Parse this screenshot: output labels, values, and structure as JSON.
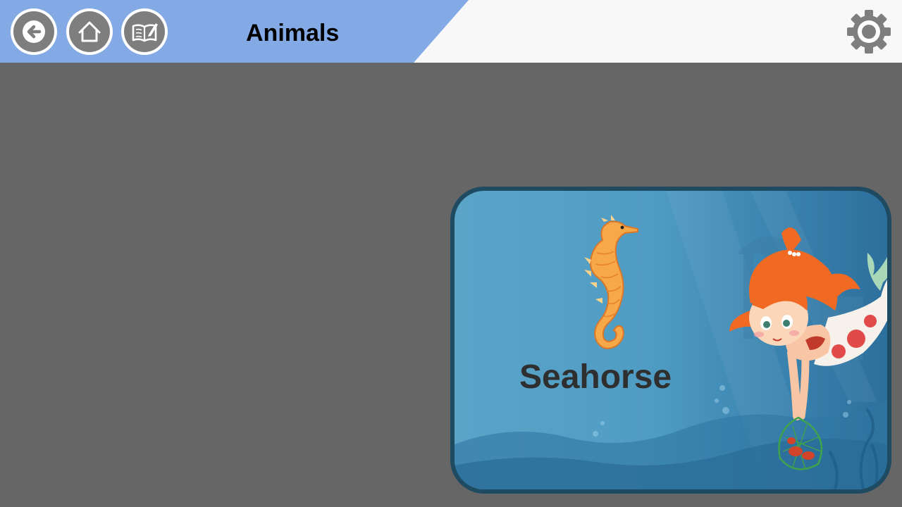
{
  "header": {
    "title": "Animals",
    "buttons": {
      "back": "back-arrow-icon",
      "home": "home-icon",
      "book": "book-edit-icon",
      "settings": "gear-icon"
    },
    "accent_color": "#83aae5",
    "button_color": "#7e7e7e"
  },
  "card": {
    "animal_name": "Seahorse",
    "frame_color": "#1e4a62",
    "illustration": "seahorse",
    "decoration": "mermaid-with-net"
  },
  "colors": {
    "background": "#666666",
    "text": "#2f2f2f"
  }
}
